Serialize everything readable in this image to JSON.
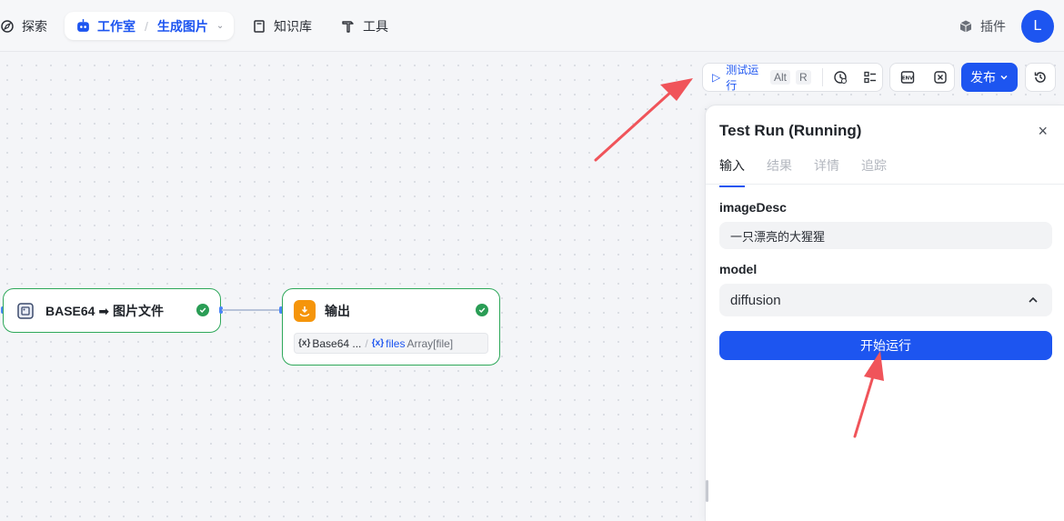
{
  "nav": {
    "explore": "探索",
    "studio": "工作室",
    "separator": "/",
    "current_project": "生成图片",
    "knowledge": "知识库",
    "tools": "工具",
    "plugins": "插件",
    "avatar_letter": "L"
  },
  "toolbar": {
    "run_label": "测试运行",
    "shortcut_alt": "Alt",
    "shortcut_key": "R",
    "env_icon_label": "ENV",
    "publish_label": "发布"
  },
  "nodes": {
    "base64": {
      "title": "BASE64 ➡ 图片文件",
      "status": "success"
    },
    "output": {
      "title": "输出",
      "status": "success",
      "var1_name": "Base64 ...",
      "var2_name": "files",
      "var2_type": "Array[file]"
    }
  },
  "panel": {
    "title": "Test Run (Running)",
    "close": "×",
    "tabs": [
      {
        "label": "输入",
        "active": true
      },
      {
        "label": "结果",
        "active": false
      },
      {
        "label": "详情",
        "active": false
      },
      {
        "label": "追踪",
        "active": false
      }
    ],
    "fields": {
      "image_desc": {
        "label": "imageDesc",
        "value": "一只漂亮的大猩猩"
      },
      "model": {
        "label": "model",
        "value": "diffusion"
      }
    },
    "start_button": "开始运行"
  },
  "colors": {
    "accent": "#1d55f0",
    "success": "#2a9d55",
    "annotation_arrow": "#f0545a"
  }
}
